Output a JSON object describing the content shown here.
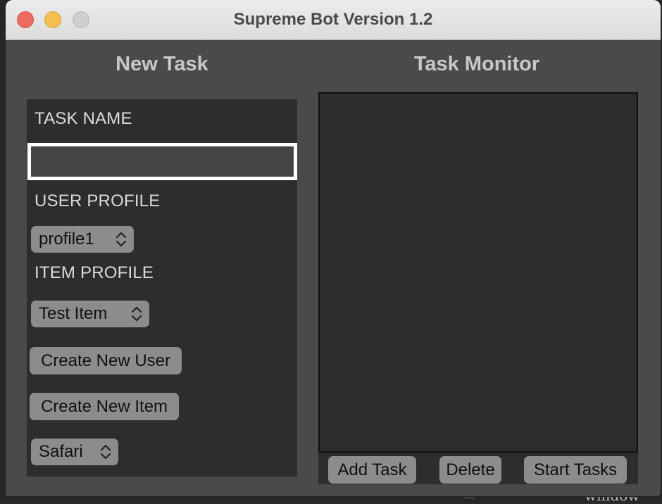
{
  "window": {
    "title": "Supreme Bot Version 1.2"
  },
  "background": {
    "corner_text": "wındow",
    "small_mark": "20|"
  },
  "new_task": {
    "heading": "New Task",
    "task_name_label": "TASK NAME",
    "task_name_value": "",
    "user_profile_label": "USER PROFILE",
    "user_profile_selected": "profile1",
    "item_profile_label": "ITEM PROFILE",
    "item_profile_selected": "Test Item",
    "create_user_label": "Create New User",
    "create_item_label": "Create New Item",
    "browser_selected": "Safari"
  },
  "task_monitor": {
    "heading": "Task Monitor",
    "tasks": [],
    "add_task_label": "Add Task",
    "delete_label": "Delete",
    "start_tasks_label": "Start Tasks"
  },
  "colors": {
    "window_bg": "#4a4a4a",
    "panel_bg": "#2d2d2d",
    "button_bg": "#8c8c8c",
    "close": "#ed6a5e",
    "minimize": "#f5bf4f",
    "zoom_inactive": "#cfcfcf"
  },
  "icons": {
    "stepper": "chevron-up-down-icon"
  }
}
